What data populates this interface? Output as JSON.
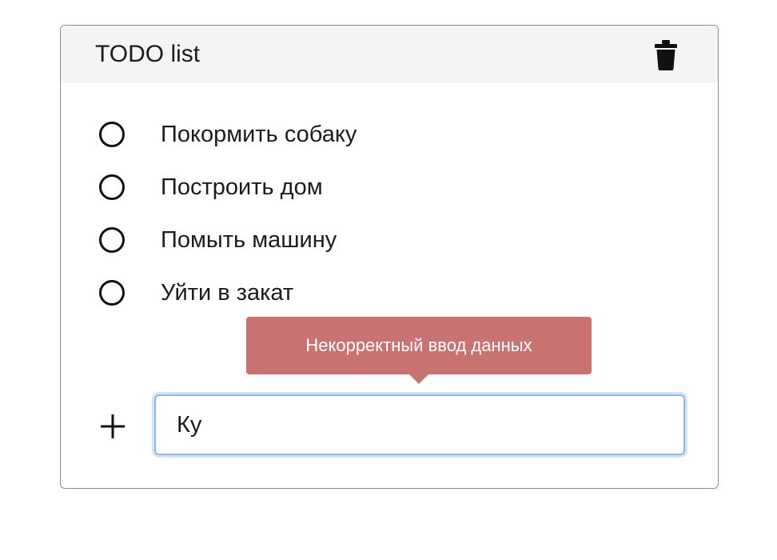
{
  "card": {
    "title": "TODO list",
    "header_icon": "trash-icon"
  },
  "todos": [
    {
      "label": "Покормить собаку",
      "done": false
    },
    {
      "label": "Построить дом",
      "done": false
    },
    {
      "label": "Помыть машину",
      "done": false
    },
    {
      "label": "Уйти в закат",
      "done": false
    }
  ],
  "tooltip": {
    "text": "Некорректный ввод данных",
    "color": "#c87272"
  },
  "new_todo": {
    "add_icon": "plus-icon",
    "value": "Ку",
    "placeholder": ""
  },
  "colors": {
    "header_bg": "#f4f4f4",
    "input_focus_border": "#8fb8ea",
    "error_tooltip": "#c87272"
  }
}
